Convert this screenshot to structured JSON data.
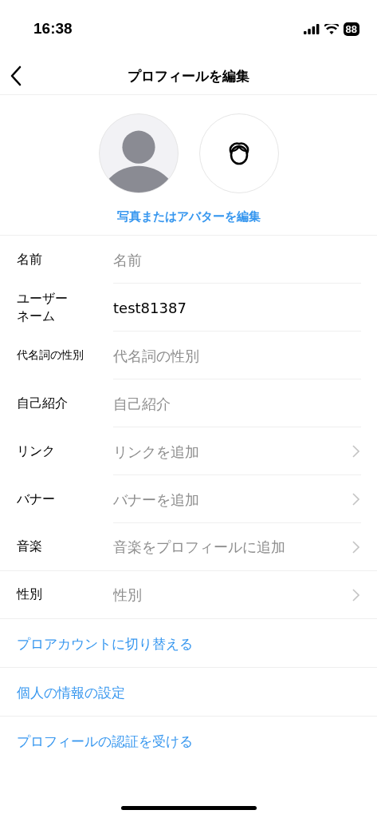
{
  "status_bar": {
    "time": "16:38",
    "battery": "88"
  },
  "nav": {
    "title": "プロフィールを編集"
  },
  "avatar": {
    "edit_link": "写真またはアバターを編集"
  },
  "field_groups": [
    [
      {
        "label": "名前",
        "placeholder": "名前",
        "kind": "text"
      },
      {
        "label": "ユーザーネーム",
        "value": "test81387",
        "kind": "text"
      },
      {
        "label": "代名詞の性別",
        "placeholder": "代名詞の性別",
        "kind": "text"
      },
      {
        "label": "自己紹介",
        "placeholder": "自己紹介",
        "kind": "text"
      },
      {
        "label": "リンク",
        "placeholder": "リンクを追加",
        "kind": "nav"
      },
      {
        "label": "バナー",
        "placeholder": "バナーを追加",
        "kind": "nav"
      },
      {
        "label": "音楽",
        "placeholder": "音楽をプロフィールに追加",
        "kind": "nav"
      }
    ],
    [
      {
        "label": "性別",
        "placeholder": "性別",
        "kind": "nav"
      }
    ]
  ],
  "links": [
    "プロアカウントに切り替える",
    "個人の情報の設定",
    "プロフィールの認証を受ける"
  ]
}
